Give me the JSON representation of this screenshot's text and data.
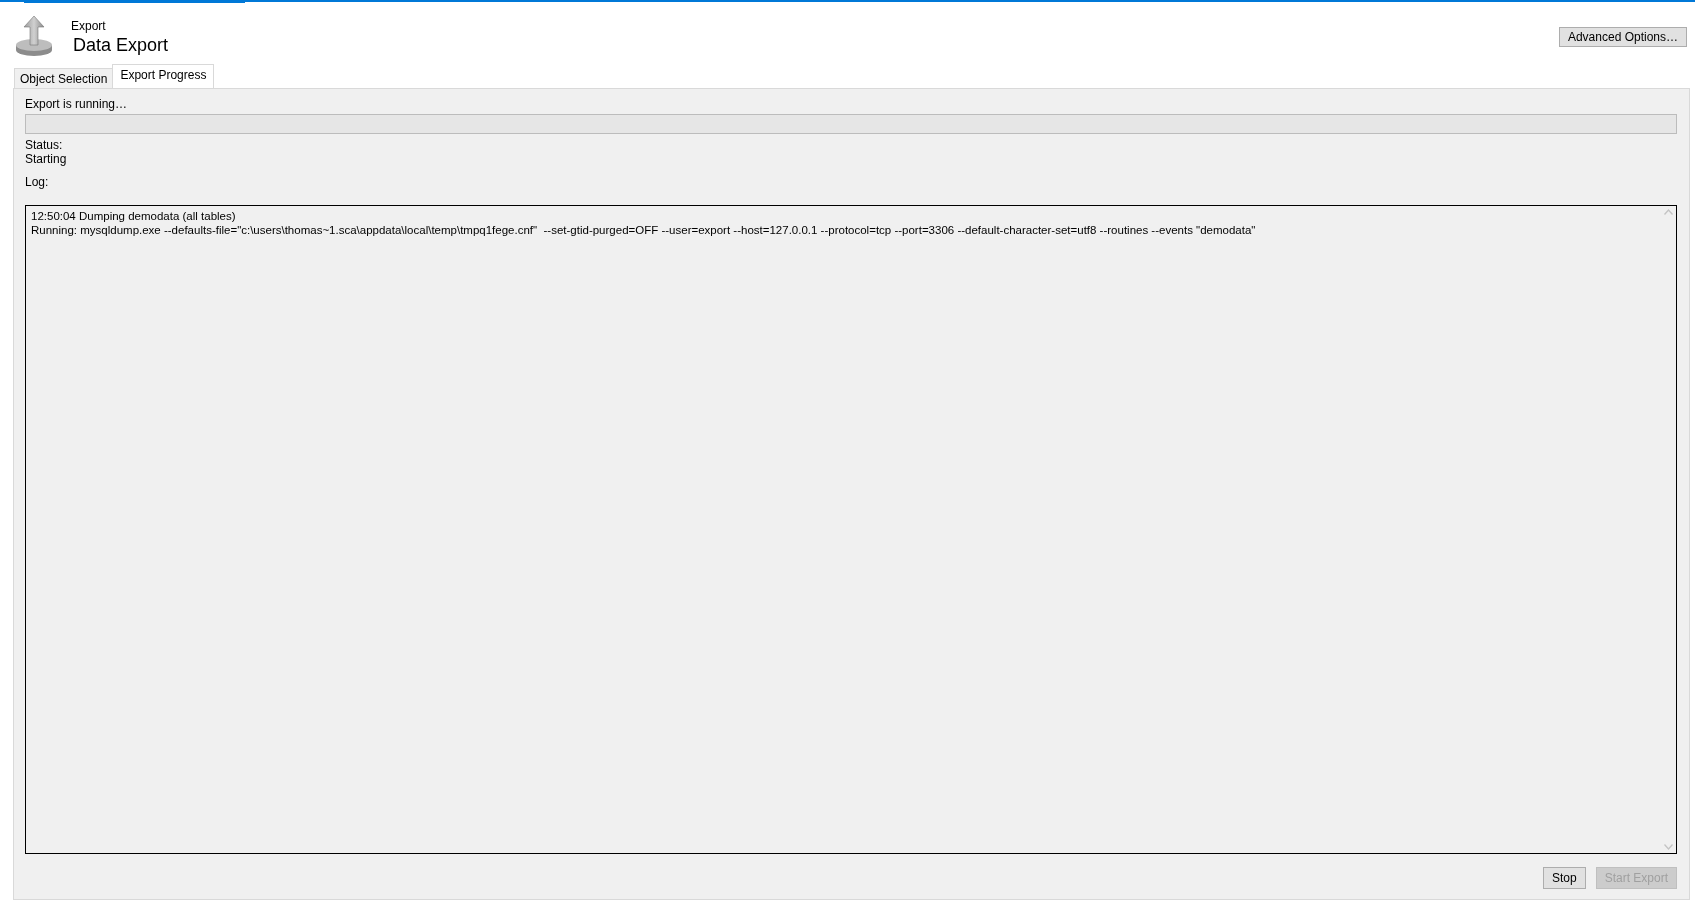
{
  "header": {
    "subtitle": "Export",
    "title": "Data Export",
    "advanced_button": "Advanced Options…"
  },
  "tabs": [
    {
      "label": "Object Selection",
      "selected": false
    },
    {
      "label": "Export Progress",
      "selected": true
    }
  ],
  "progress": {
    "label": "Export is running…",
    "level": 0
  },
  "status": {
    "label": "Status:",
    "value": "Starting"
  },
  "log": {
    "label": "Log:",
    "lines": [
      "12:50:04 Dumping demodata (all tables)",
      "Running: mysqldump.exe --defaults-file=\"c:\\users\\thomas~1.sca\\appdata\\local\\temp\\tmpq1fege.cnf\"  --set-gtid-purged=OFF --user=export --host=127.0.0.1 --protocol=tcp --port=3306 --default-character-set=utf8 --routines --events \"demodata\""
    ]
  },
  "buttons": [
    {
      "label": "Stop",
      "disabled": false
    },
    {
      "label": "Start Export",
      "disabled": true
    }
  ]
}
